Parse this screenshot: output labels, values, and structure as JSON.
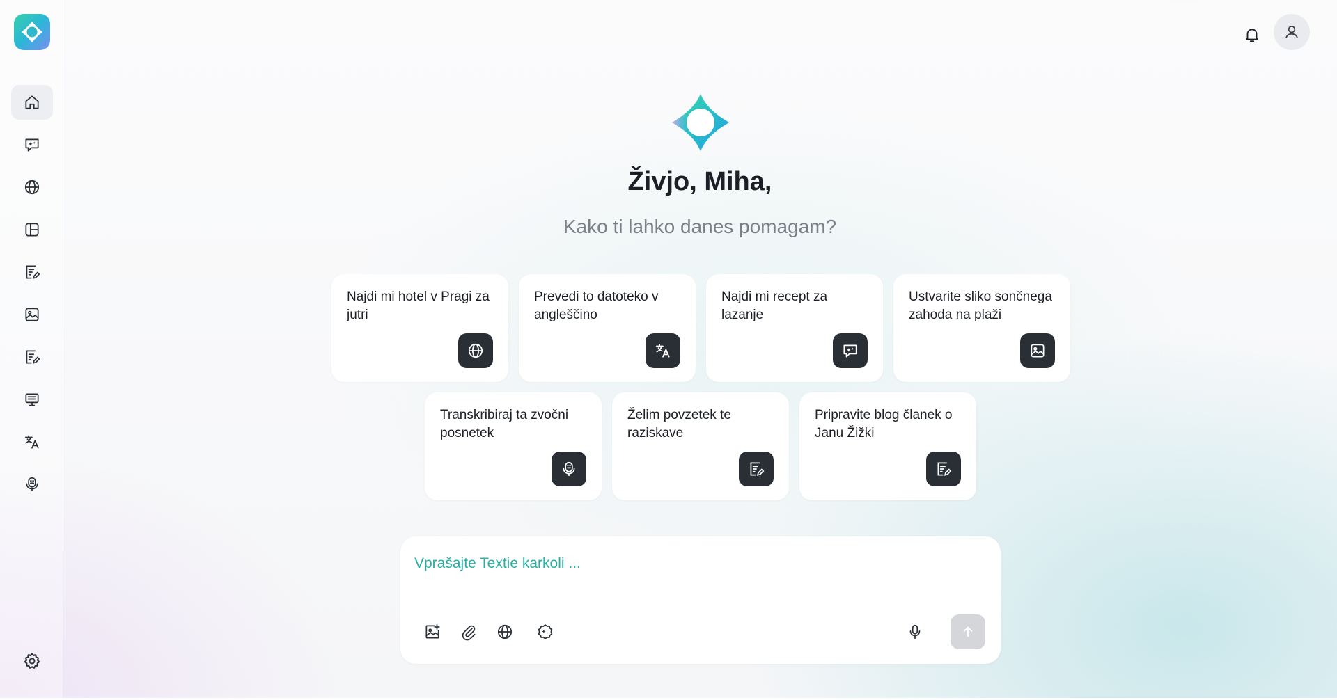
{
  "colors": {
    "accent": "#27b0a0",
    "card_icon_bg": "#2a2f36",
    "send_disabled": "#d4d6da"
  },
  "sidebar": {
    "logo": "textie-logo",
    "items": [
      {
        "icon": "home-icon",
        "active": true
      },
      {
        "icon": "chat-sparkle-icon",
        "active": false
      },
      {
        "icon": "globe-icon",
        "active": false
      },
      {
        "icon": "layout-icon",
        "active": false
      },
      {
        "icon": "document-edit-icon",
        "active": false
      },
      {
        "icon": "image-icon",
        "active": false
      },
      {
        "icon": "document-edit-icon",
        "active": false
      },
      {
        "icon": "monitor-icon",
        "active": false
      },
      {
        "icon": "translate-icon",
        "active": false
      },
      {
        "icon": "transcribe-icon",
        "active": false
      }
    ],
    "settings_icon": "gear-icon"
  },
  "header": {
    "notifications_icon": "bell-icon",
    "avatar_icon": "user-icon"
  },
  "main": {
    "greeting": "Živjo, Miha,",
    "subtitle": "Kako ti lahko danes pomagam?",
    "suggestions": [
      {
        "label": "Najdi mi hotel v Pragi za jutri",
        "icon": "globe-icon"
      },
      {
        "label": "Prevedi to datoteko v angleščino",
        "icon": "translate-icon"
      },
      {
        "label": "Najdi mi recept za lazanje",
        "icon": "chat-sparkle-icon"
      },
      {
        "label": "Ustvarite sliko sončnega zahoda na plaži",
        "icon": "image-icon"
      },
      {
        "label": "Transkribiraj ta zvočni posnetek",
        "icon": "transcribe-icon"
      },
      {
        "label": "Želim povzetek te raziskave",
        "icon": "document-edit-icon"
      },
      {
        "label": "Pripravite blog članek o Janu Žižki",
        "icon": "document-edit-icon"
      }
    ]
  },
  "composer": {
    "placeholder": "Vprašajte Textie karkoli ...",
    "value": "",
    "tools": [
      "add-image-icon",
      "paperclip-icon",
      "globe-icon",
      "sparkle-badge-icon"
    ],
    "mic_icon": "microphone-icon",
    "send_icon": "arrow-up-icon"
  }
}
